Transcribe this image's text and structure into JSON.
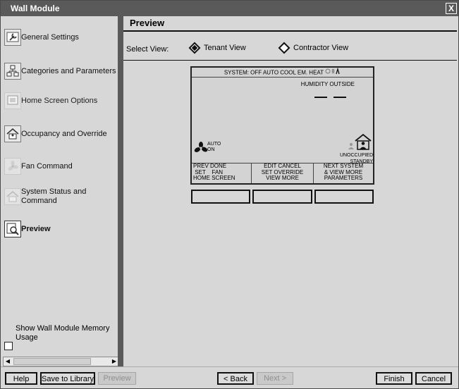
{
  "window": {
    "title": "Wall Module",
    "close_label": "X"
  },
  "sidebar": {
    "items": [
      {
        "label": "General Settings",
        "icon": "settings-wrench-icon"
      },
      {
        "label": "Categories and Parameters",
        "icon": "hierarchy-icon"
      },
      {
        "label": "Home Screen Options",
        "icon": "home-screen-icon"
      },
      {
        "label": "Occupancy and Override",
        "icon": "occupancy-house-icon"
      },
      {
        "label": "Fan Command",
        "icon": "fan-icon"
      },
      {
        "label": "System Status and Command",
        "icon": "system-status-icon"
      },
      {
        "label": "Preview",
        "icon": "preview-magnifier-icon"
      }
    ],
    "memory_checkbox_label": "Show Wall Module Memory Usage"
  },
  "main": {
    "title": "Preview",
    "select_view_label": "Select View:",
    "views": [
      {
        "label": "Tenant View",
        "selected": true
      },
      {
        "label": "Contractor View",
        "selected": false
      }
    ]
  },
  "device": {
    "top_bar": "SYSTEM: OFF AUTO COOL EM. HEAT",
    "humidity_label": "HUMIDITY OUTSIDE",
    "humidity_value": "— —",
    "fan_line1": "AUTO",
    "fan_line2": "ON",
    "occupancy_line1": "UNOCCUPIED",
    "occupancy_line2": "STANDBY",
    "softkeys": [
      "PREV DONE\n SET    FAN\nHOME SCREEN",
      "EDIT CANCEL\nSET OVERRIDE\nVIEW MORE",
      "NEXT SYSTEM\n& VIEW MORE\nPARAMETERS"
    ]
  },
  "buttons": {
    "help": "Help",
    "save_to_library": "Save to Library",
    "preview": "Preview",
    "back": "< Back",
    "next": "Next >",
    "finish": "Finish",
    "cancel": "Cancel"
  },
  "colors": {
    "title_bar": "#5a5a5a",
    "panel_bg": "#d7d7d7",
    "accent_dark": "#111111"
  }
}
